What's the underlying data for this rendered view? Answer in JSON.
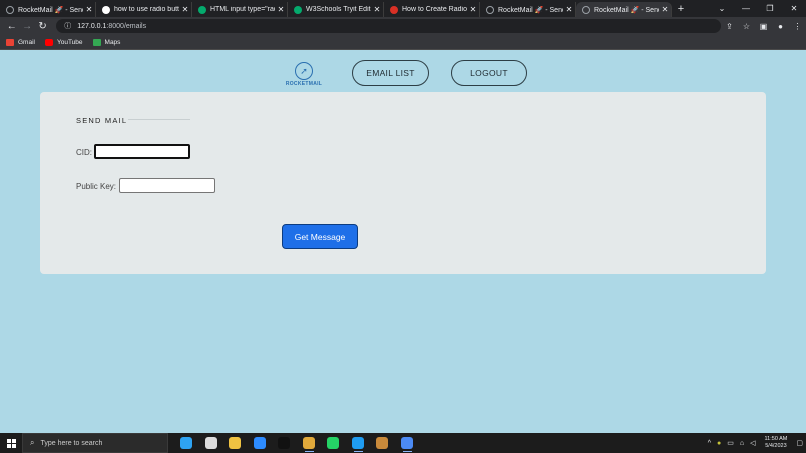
{
  "browser": {
    "tabs": [
      {
        "title": "RocketMail 🚀 - Send M",
        "favicon": "globe",
        "color": "#9aa0a6"
      },
      {
        "title": "how to use radio butto",
        "favicon": "G",
        "color": "#ffffff"
      },
      {
        "title": "HTML input type=\"radio",
        "favicon": "W",
        "color": "#04aa6d"
      },
      {
        "title": "W3Schools Tryit Editor",
        "favicon": "W",
        "color": "#04aa6d"
      },
      {
        "title": "How to Create Radio B",
        "favicon": "Y",
        "color": "#d93025"
      },
      {
        "title": "RocketMail 🚀 - Send M",
        "favicon": "globe",
        "color": "#9aa0a6"
      },
      {
        "title": "RocketMail 🚀 - Send M",
        "favicon": "globe",
        "color": "#9aa0a6"
      }
    ],
    "active_tab_index": 6,
    "new_tab": "+",
    "window_controls": {
      "menu": "⌄",
      "minimize": "—",
      "restore": "❐",
      "close": "✕"
    },
    "url_host": "127.0.0.1",
    "url_path": ":8000/emails",
    "bookmarks": [
      {
        "label": "Gmail",
        "color": "#ea4335"
      },
      {
        "label": "YouTube",
        "color": "#ff0000"
      },
      {
        "label": "Maps",
        "color": "#34a853"
      }
    ]
  },
  "app": {
    "logo_text": "ROCKETMAIL",
    "nav": {
      "email_list": "EMAIL LIST",
      "logout": "LOGOUT"
    },
    "form": {
      "heading": "SEND MAIL",
      "cid_label": "CID:",
      "cid_value": "",
      "key_label": "Public Key:",
      "key_value": "",
      "submit": "Get Message"
    }
  },
  "taskbar": {
    "search_placeholder": "Type here to search",
    "apps": [
      {
        "name": "edge-icon",
        "color": "#2ea3f2",
        "running": false
      },
      {
        "name": "calendar-icon",
        "color": "#dcdcdc",
        "running": false
      },
      {
        "name": "file-explorer-icon",
        "color": "#f0c342",
        "running": false
      },
      {
        "name": "zoom-icon",
        "color": "#2d8cff",
        "running": false
      },
      {
        "name": "terminal-icon",
        "color": "#111111",
        "running": false
      },
      {
        "name": "chrome-icon",
        "color": "#e0a93b",
        "running": true
      },
      {
        "name": "whatsapp-icon",
        "color": "#25d366",
        "running": false
      },
      {
        "name": "vscode-icon",
        "color": "#1f9cf0",
        "running": true
      },
      {
        "name": "package-icon",
        "color": "#c98a3b",
        "running": false
      },
      {
        "name": "chrome-icon-2",
        "color": "#4c8bf5",
        "running": true
      }
    ],
    "time": "11:50 AM",
    "date": "5/4/2023"
  }
}
